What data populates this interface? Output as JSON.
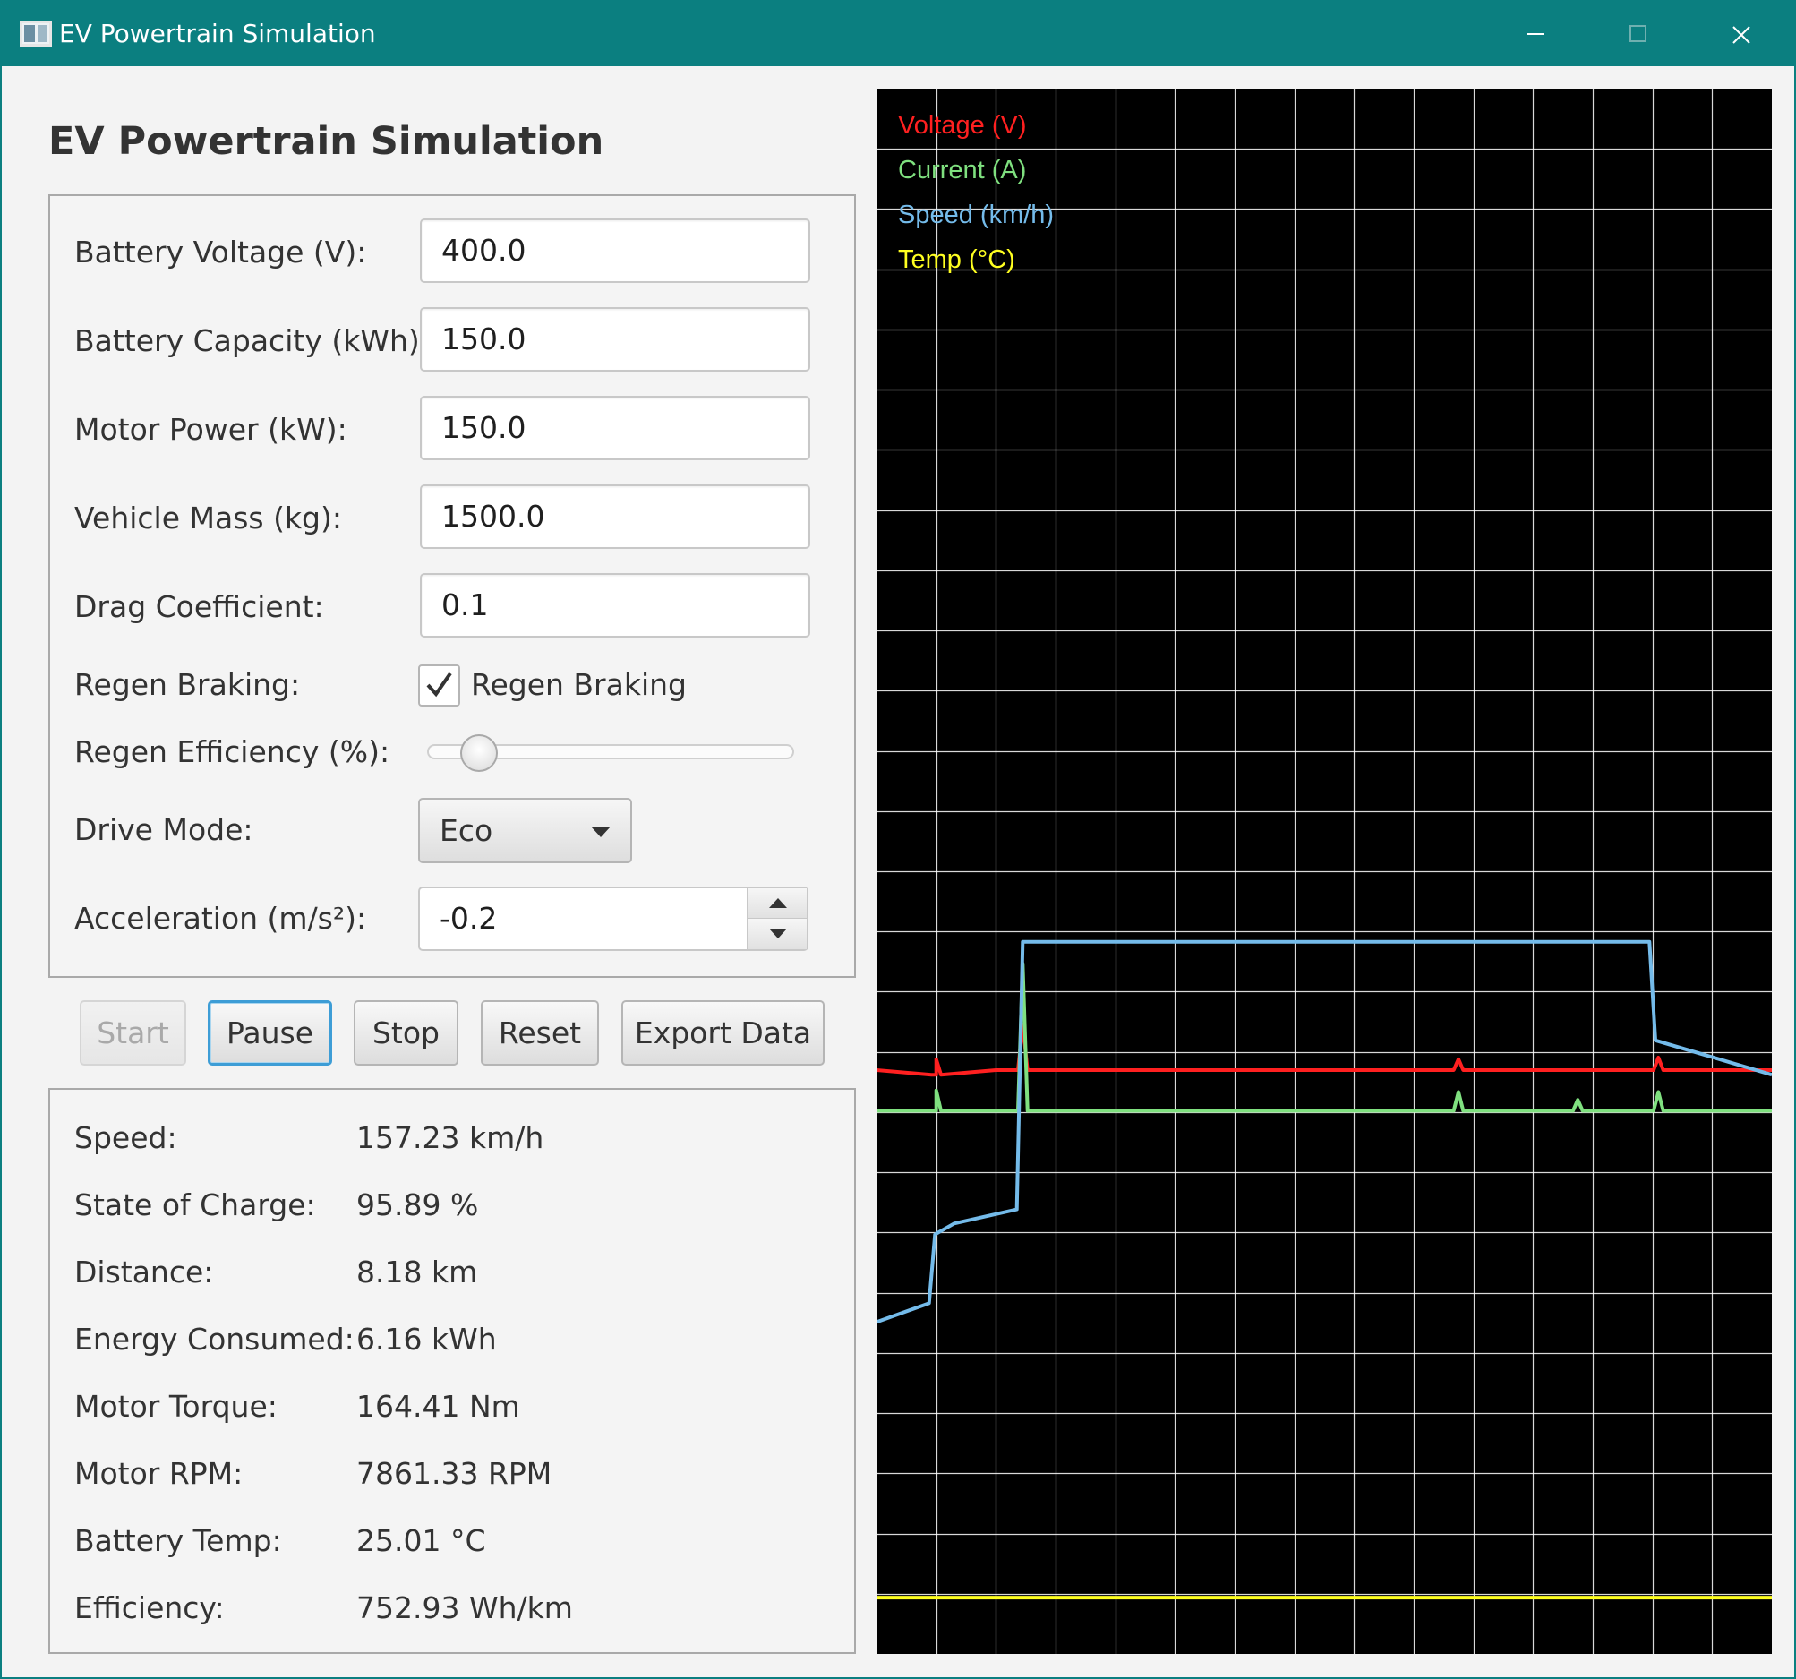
{
  "window": {
    "title": "EV Powertrain Simulation",
    "colors": {
      "titlebar": "#0b7f80",
      "accent_focus": "#3d9dd6"
    }
  },
  "heading": "EV Powertrain Simulation",
  "form": {
    "battery_voltage": {
      "label": "Battery Voltage (V):",
      "value": "400.0"
    },
    "battery_capacity": {
      "label": "Battery Capacity (kWh):",
      "value": "150.0"
    },
    "motor_power": {
      "label": "Motor Power (kW):",
      "value": "150.0"
    },
    "vehicle_mass": {
      "label": "Vehicle Mass (kg):",
      "value": "1500.0"
    },
    "drag_coefficient": {
      "label": "Drag Coefficient:",
      "value": "0.1"
    },
    "regen_braking": {
      "label": "Regen Braking:",
      "checkbox_label": "Regen Braking",
      "checked": true
    },
    "regen_efficiency": {
      "label": "Regen Efficiency (%):",
      "slider_fraction": 0.12
    },
    "drive_mode": {
      "label": "Drive Mode:",
      "value": "Eco"
    },
    "acceleration": {
      "label": "Acceleration (m/s²):",
      "value": "-0.2"
    }
  },
  "buttons": {
    "start": {
      "label": "Start",
      "enabled": false
    },
    "pause": {
      "label": "Pause",
      "focused": true
    },
    "stop": {
      "label": "Stop"
    },
    "reset": {
      "label": "Reset"
    },
    "export": {
      "label": "Export Data"
    }
  },
  "stats": [
    {
      "label": "Speed:",
      "value": "157.23 km/h"
    },
    {
      "label": "State of Charge:",
      "value": "95.89 %"
    },
    {
      "label": "Distance:",
      "value": "8.18 km"
    },
    {
      "label": "Energy Consumed:",
      "value": "6.16 kWh"
    },
    {
      "label": "Motor Torque:",
      "value": "164.41 Nm"
    },
    {
      "label": "Motor RPM:",
      "value": "7861.33 RPM"
    },
    {
      "label": "Battery Temp:",
      "value": "25.01 °C"
    },
    {
      "label": "Efficiency:",
      "value": "752.93 Wh/km"
    }
  ],
  "chart_data": {
    "type": "line",
    "background": "#000000",
    "grid": true,
    "grid_color": "#ffffff",
    "legend_placement": "top-left",
    "x": [
      0,
      1,
      2,
      3,
      4,
      5,
      6,
      7,
      8,
      9,
      10,
      11,
      12,
      13,
      14,
      15
    ],
    "ylim": [
      0,
      1
    ],
    "series": [
      {
        "name": "Voltage (V)",
        "color": "#ff2020",
        "values": [
          0.373,
          0.37,
          0.373,
          0.373,
          0.373,
          0.373,
          0.373,
          0.373,
          0.373,
          0.373,
          0.373,
          0.373,
          0.373,
          0.373,
          0.373,
          0.373
        ],
        "spikes": [
          [
            1,
            0.38
          ],
          [
            2.45,
            0.402
          ],
          [
            9.75,
            0.38
          ],
          [
            13.1,
            0.381
          ]
        ]
      },
      {
        "name": "Current (A)",
        "color": "#7fe07f",
        "values": [
          0.347,
          0.347,
          0.347,
          0.347,
          0.347,
          0.347,
          0.347,
          0.347,
          0.347,
          0.347,
          0.347,
          0.347,
          0.347,
          0.347,
          0.347,
          0.347
        ],
        "spikes": [
          [
            1,
            0.36
          ],
          [
            2.45,
            0.441
          ],
          [
            9.75,
            0.359
          ],
          [
            11.75,
            0.354
          ],
          [
            13.1,
            0.359
          ]
        ]
      },
      {
        "name": "Speed (km/h)",
        "color": "#74bbea",
        "values": [
          0.212,
          0.224,
          0.268,
          0.284,
          0.455,
          0.455,
          0.455,
          0.455,
          0.455,
          0.455,
          0.455,
          0.455,
          0.455,
          0.455,
          0.392,
          0.37
        ]
      },
      {
        "name": "Temp (°C)",
        "color": "#ffff20",
        "values": [
          0.036,
          0.036,
          0.036,
          0.036,
          0.036,
          0.036,
          0.036,
          0.036,
          0.036,
          0.036,
          0.036,
          0.036,
          0.036,
          0.036,
          0.036,
          0.036
        ]
      }
    ]
  }
}
